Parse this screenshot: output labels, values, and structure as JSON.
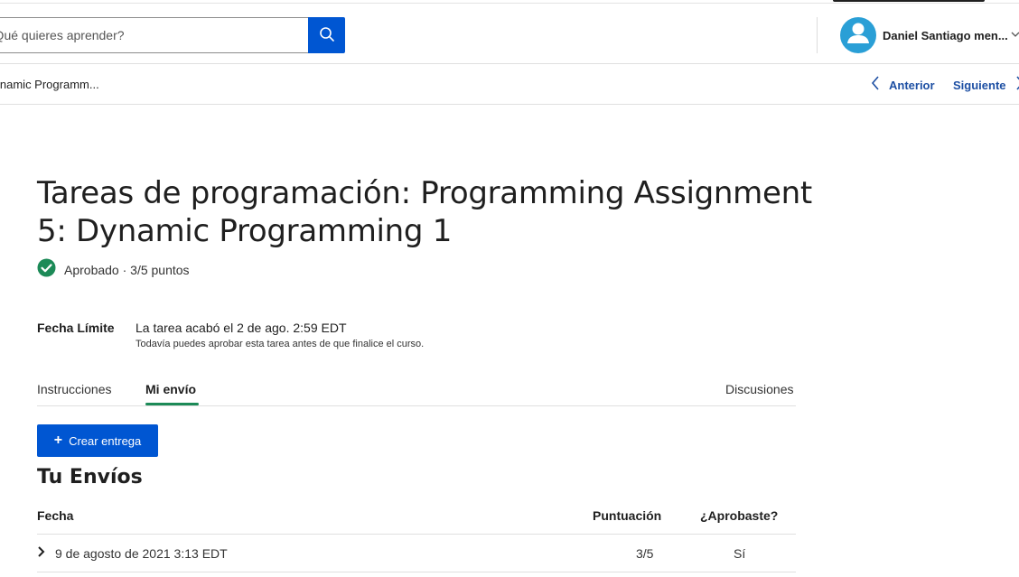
{
  "search": {
    "placeholder": "¿Qué quieres aprender?"
  },
  "user": {
    "name": "Daniel Santiago men..."
  },
  "breadcrumb": {
    "current": "Dynamic Programm..."
  },
  "nav": {
    "prev_label": "Anterior",
    "next_label": "Siguiente"
  },
  "assignment": {
    "title": "Tareas de programación: Programming Assignment 5: Dynamic Programming 1",
    "status": "Aprobado · 3/5 puntos",
    "deadline_label": "Fecha Límite",
    "deadline_value": "La tarea acabó el 2 de ago. 2:59 EDT",
    "deadline_note": "Todavía puedes aprobar esta tarea antes de que finalice el curso."
  },
  "tabs": {
    "instructions": "Instrucciones",
    "my_submission": "Mi envío",
    "discussions": "Discusiones"
  },
  "create_button": {
    "label": "Crear entrega"
  },
  "submissions": {
    "title": "Tu Envíos",
    "columns": {
      "date": "Fecha",
      "score": "Puntuación",
      "passed": "¿Aprobaste?"
    },
    "rows": [
      {
        "date": "9 de agosto de 2021 3:13 EDT",
        "score": "3/5",
        "passed": "Sí"
      }
    ]
  },
  "colors": {
    "brand_blue": "#0056d2",
    "link_blue": "#1d4fa3",
    "success_green": "#1c8a57",
    "avatar_blue": "#2a9fd6"
  }
}
